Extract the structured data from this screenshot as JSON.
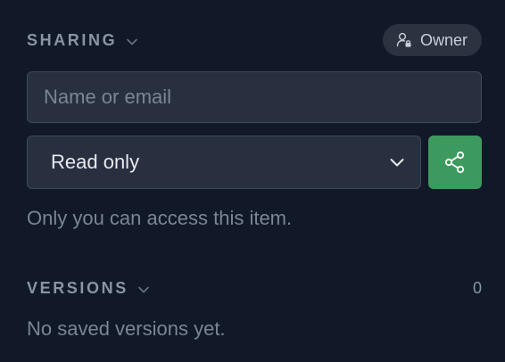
{
  "sharing": {
    "title": "SHARING",
    "owner_label": "Owner",
    "input_placeholder": "Name or email",
    "input_value": "",
    "permission_selected": "Read only",
    "info": "Only you can access this item."
  },
  "versions": {
    "title": "VERSIONS",
    "count": "0",
    "empty_text": "No saved versions yet."
  },
  "colors": {
    "background": "#111827",
    "share_button": "#3d9a5e"
  },
  "icons": {
    "sharing_chevron": "chevron-down-icon",
    "owner": "user-lock-icon",
    "select_chevron": "chevron-down-icon",
    "share": "share-icon",
    "versions_chevron": "chevron-down-icon"
  }
}
